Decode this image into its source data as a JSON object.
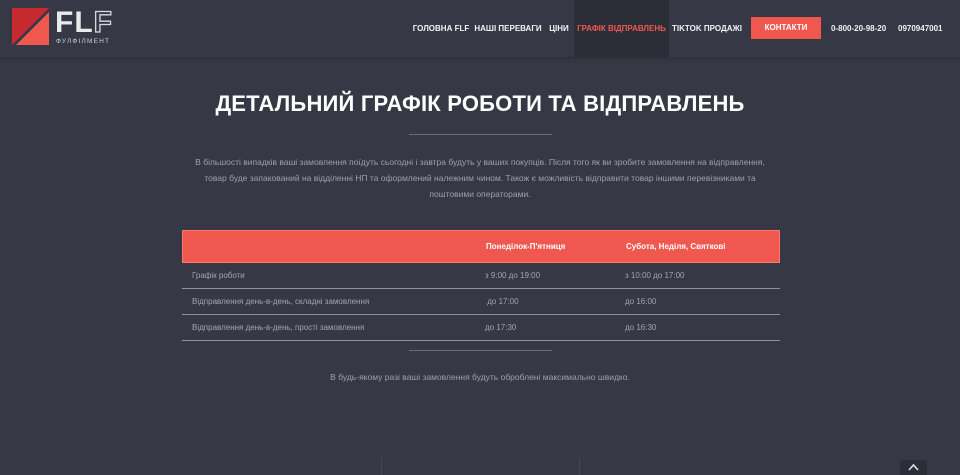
{
  "brand": {
    "logo_text_a": "FL",
    "logo_text_b": "F",
    "logo_sub": "ФУЛФІЛМЕНТ",
    "accent": "#f0584f"
  },
  "nav": {
    "items": [
      {
        "label": "ГОЛОВНА FLF",
        "active": false
      },
      {
        "label": "НАШІ ПЕРЕВАГИ",
        "active": false
      },
      {
        "label": "ЦІНИ",
        "active": false
      },
      {
        "label": "ГРАФІК ВІДПРАВЛЕНЬ",
        "active": true
      },
      {
        "label": "TIKTOK ПРОДАЖІ",
        "active": false
      }
    ],
    "contacts_label": "КОНТАКТИ",
    "phones": [
      "0-800-20-98-20",
      "0970947001"
    ]
  },
  "content": {
    "title": "ДЕТАЛЬНИЙ ГРАФІК РОБОТИ ТА ВІДПРАВЛЕНЬ",
    "intro_lines": [
      "В більшості випадків ваші замовлення поїдуть сьогодні і завтра будуть у ваших покупців.  Після того як ви зробите замовлення на відправлення,",
      "товар буде запакований на відділенні НП та оформлений належним чином. Також є можливість відправити товар іншими перевізниками та",
      "поштовими операторами."
    ],
    "table": {
      "headers": [
        "",
        "Понеділок-П'ятниця",
        "Субота, Неділя, Святкові"
      ],
      "rows": [
        [
          "Графік роботи",
          "з 9:00 до 19:00",
          "з 10:00 до 17:00"
        ],
        [
          "Відправлення день-в-день, складні замовлення",
          " до 17:00",
          "до 16:00"
        ],
        [
          "Відправлення день-в-день, прості замовлення",
          "до 17:30",
          "до 16:30"
        ]
      ]
    },
    "footer_note": "В будь-якому разі ваші замовлення будуть оброблені максимально швидко."
  },
  "icons": {
    "logo": "flf-logo-icon",
    "scroll_top": "chevron-up-icon"
  }
}
